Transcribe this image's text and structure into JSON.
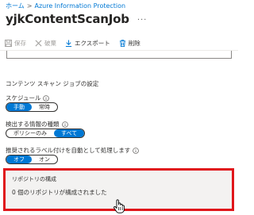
{
  "breadcrumb": {
    "home": "ホーム",
    "separator": ">",
    "current": "Azure Information Protection"
  },
  "page": {
    "title": "yjkContentScanJob",
    "more": "···"
  },
  "toolbar": {
    "save": "保存",
    "discard": "破棄",
    "export": "エクスポート",
    "delete": "削除"
  },
  "section": {
    "title": "コンテンツ スキャン ジョブの設定"
  },
  "schedule": {
    "label": "スケジュール",
    "options": [
      "手動",
      "常時"
    ],
    "selected": "手動"
  },
  "info_types": {
    "label": "検出する情報の種類",
    "options": [
      "ポリシーのみ",
      "すべて"
    ],
    "selected": "すべて"
  },
  "recommended": {
    "label": "推奨されるラベル付けを自動として処理します",
    "options": [
      "オフ",
      "オン"
    ],
    "selected": "オフ"
  },
  "repositories": {
    "title": "リポジトリの構成",
    "value": "0 個のリポジトリが構成されました"
  },
  "colors": {
    "accent": "#0078d4",
    "highlight": "#e0161b",
    "panel": "#f3f2f1"
  },
  "icons": [
    "save-icon",
    "discard-icon",
    "download-icon",
    "trash-icon",
    "info-icon",
    "hand-cursor-icon"
  ]
}
